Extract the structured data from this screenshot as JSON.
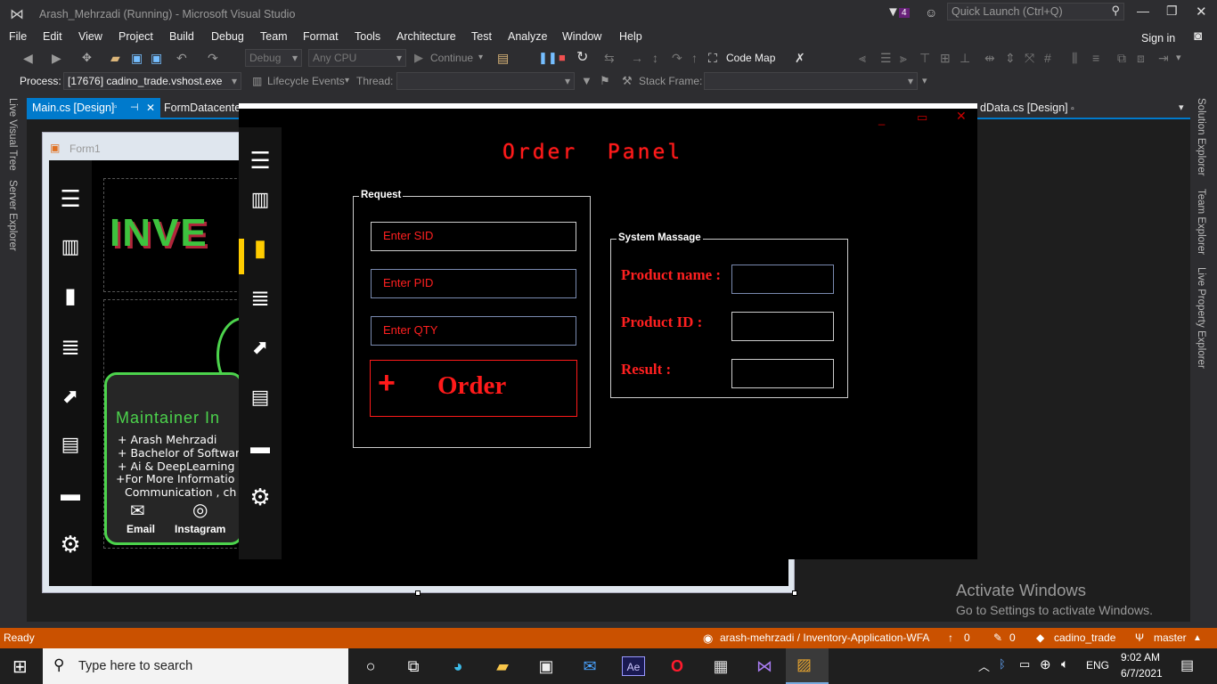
{
  "titlebar": {
    "title": "Arash_Mehrzadi (Running) - Microsoft Visual Studio",
    "notif_count": "4",
    "quick_launch": "Quick Launch (Ctrl+Q)"
  },
  "menu": {
    "items": [
      "File",
      "Edit",
      "View",
      "Project",
      "Build",
      "Debug",
      "Team",
      "Format",
      "Tools",
      "Architecture",
      "Test",
      "Analyze",
      "Window",
      "Help"
    ],
    "sign_in": "Sign in"
  },
  "toolbar": {
    "config": "Debug",
    "platform": "Any CPU",
    "continue": "Continue",
    "code_map": "Code Map"
  },
  "debugbar": {
    "process_label": "Process:",
    "process_value": "[17676] cadino_trade.vshost.exe",
    "lifecycle": "Lifecycle Events",
    "thread": "Thread:",
    "stack_frame": "Stack Frame:"
  },
  "side_left": [
    "Live Visual Tree",
    "Server Explorer"
  ],
  "side_right": [
    "Solution Explorer",
    "Team Explorer",
    "Live Property Explorer"
  ],
  "tabs": {
    "tab1": "Main.cs [Design]",
    "tab2": "FormDatacenter",
    "tab3": "dData.cs [Design]"
  },
  "designer": {
    "form_title": "Form1",
    "brand": "INVE",
    "maintainer_title": "Maintainer In",
    "lines": [
      "+ Arash Mehrzadi",
      "+ Bachelor of Softwar",
      "+ Ai & DeepLearning",
      "+For More Informatio",
      "Communication , ch"
    ],
    "email": "Email",
    "instagram": "Instagram"
  },
  "app": {
    "panel_title": "Order  Panel",
    "request_group": "Request",
    "sid_placeholder": "Enter SID",
    "pid_placeholder": "Enter PID",
    "qty_placeholder": "Enter QTY",
    "order_button": "Order",
    "order_plus": "+",
    "system_group": "System Massage",
    "product_name": "Product name :",
    "product_id": "Product ID :",
    "result": "Result :",
    "accent": "#ff1a1a",
    "active_color": "#ffcc00"
  },
  "watermark": {
    "line1": "Activate Windows",
    "line2": "Go to Settings to activate Windows."
  },
  "status": {
    "ready": "Ready",
    "repo": "arash-mehrzadi / Inventory-Application-WFA",
    "up": "0",
    "pencil": "0",
    "project": "cadino_trade",
    "branch": "master",
    "color": "#ca5100"
  },
  "taskbar": {
    "search": "Type here to search",
    "lang": "ENG",
    "time": "9:02 AM",
    "date": "6/7/2021"
  }
}
